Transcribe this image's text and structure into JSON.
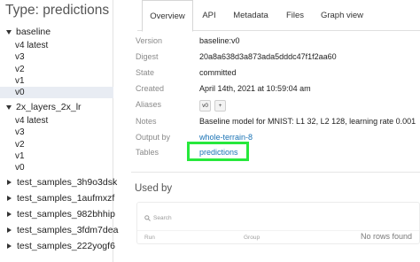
{
  "sidebar": {
    "title": "Type: predictions",
    "groups": [
      {
        "name": "baseline",
        "expanded": true,
        "versions": [
          "v4 latest",
          "v3",
          "v2",
          "v1",
          "v0"
        ],
        "selected": "v0"
      },
      {
        "name": "2x_layers_2x_lr",
        "expanded": true,
        "versions": [
          "v4 latest",
          "v3",
          "v2",
          "v1",
          "v0"
        ]
      },
      {
        "name": "test_samples_3h9o3dsk",
        "expanded": false
      },
      {
        "name": "test_samples_1aufmxzf",
        "expanded": false
      },
      {
        "name": "test_samples_982bhhip",
        "expanded": false
      },
      {
        "name": "test_samples_3fdm7dea",
        "expanded": false
      },
      {
        "name": "test_samples_222yogf6",
        "expanded": false
      }
    ]
  },
  "tabs": [
    "Overview",
    "API",
    "Metadata",
    "Files",
    "Graph view"
  ],
  "active_tab": "Overview",
  "overview": {
    "version": {
      "key": "Version",
      "value": "baseline:v0"
    },
    "digest": {
      "key": "Digest",
      "value": "20a8a638d3a873ada5dddc47f1f2aa60"
    },
    "state": {
      "key": "State",
      "value": "committed"
    },
    "created": {
      "key": "Created",
      "value": "April 14th, 2021 at 10:59:04 am"
    },
    "aliases": {
      "key": "Aliases",
      "chip": "v0",
      "add_label": "+"
    },
    "notes": {
      "key": "Notes",
      "value": "Baseline model for MNIST: L1 32, L2 128, learning rate 0.001"
    },
    "output_by": {
      "key": "Output by",
      "value": "whole-terrain-8"
    },
    "tables": {
      "key": "Tables",
      "value": "predictions"
    }
  },
  "used_by": {
    "title": "Used by",
    "search_placeholder": "Search",
    "columns": [
      "Run",
      "Group"
    ],
    "empty_text": "No rows found"
  },
  "colors": {
    "link": "#1a73b5",
    "highlight": "#27e83c",
    "selected_row": "#e8ecf3"
  }
}
